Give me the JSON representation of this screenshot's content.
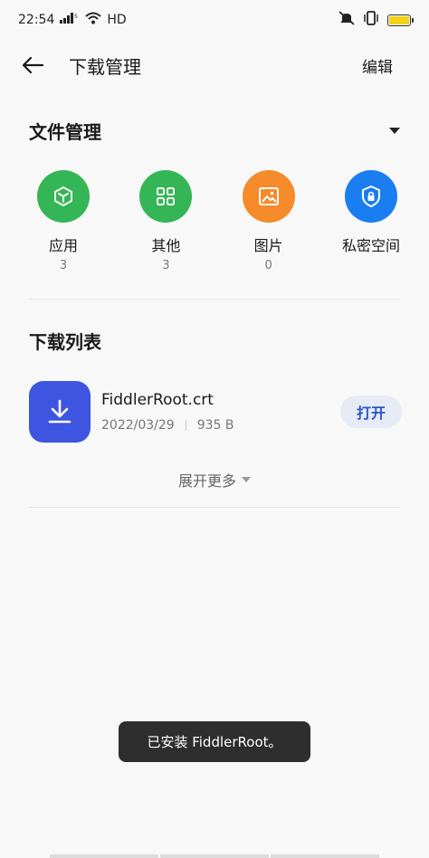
{
  "status_bar": {
    "time": "22:54",
    "network": "HD",
    "battery_color": "#f2d21a"
  },
  "header": {
    "back_icon": "arrow-left-icon",
    "title": "下载管理",
    "edit_label": "编辑"
  },
  "file_management": {
    "title": "文件管理",
    "categories": [
      {
        "label": "应用",
        "count": "3",
        "color": "#34b656",
        "icon": "cube-icon"
      },
      {
        "label": "其他",
        "count": "3",
        "color": "#34b656",
        "icon": "grid-icon"
      },
      {
        "label": "图片",
        "count": "0",
        "color": "#f58b2b",
        "icon": "image-icon"
      },
      {
        "label": "私密空间",
        "count": "",
        "color": "#1a7df0",
        "icon": "shield-lock-icon"
      }
    ]
  },
  "download_list": {
    "title": "下载列表",
    "items": [
      {
        "name": "FiddlerRoot.crt",
        "date": "2022/03/29",
        "size": "935 B",
        "action_label": "打开",
        "icon": "download-icon"
      }
    ],
    "expand_label": "展开更多"
  },
  "toast": {
    "message": "已安装 FiddlerRoot。"
  }
}
